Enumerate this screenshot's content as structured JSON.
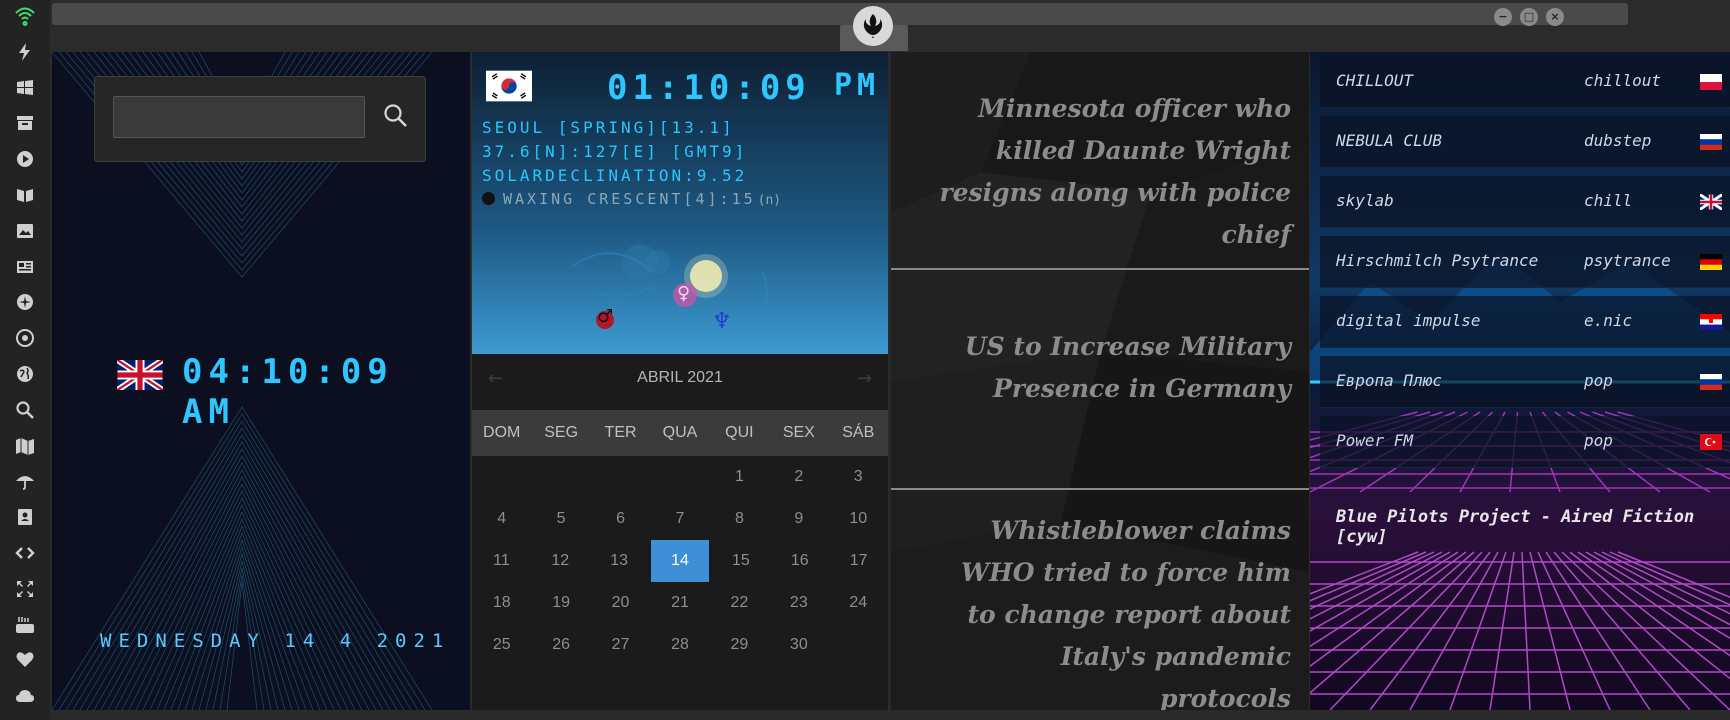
{
  "rail": {
    "icons": [
      "wifi-icon",
      "bolt-icon",
      "windows-icon",
      "archive-icon",
      "play-icon",
      "book-icon",
      "image-icon",
      "news-icon",
      "rebel-icon",
      "empire-icon",
      "globe-icon",
      "search-icon",
      "map-icon",
      "umbrella-icon",
      "contacts-icon",
      "code-icon",
      "fullscreen-icon",
      "youtube-icon",
      "heart-icon",
      "cloud-icon"
    ]
  },
  "topbar": {
    "window_buttons": [
      "−",
      "□",
      "×"
    ]
  },
  "uk_clock": {
    "search_placeholder": "",
    "time": "04:10:09 AM",
    "date": "WEDNESDAY 14 4 2021"
  },
  "seoul": {
    "time": "01:10:09",
    "ampm": "PM",
    "line1": "SEOUL [SPRING][13.1]",
    "line2": "37.6[N]:127[E] [GMT9]",
    "line3": "SOLARDECLINATION:9.52",
    "moon": "WAXING CRESCENT[4]:15",
    "moon_suffix": "(n)",
    "planet_symbols": [
      "♀",
      "♂",
      "♆"
    ]
  },
  "calendar": {
    "prev": "←",
    "next": "→",
    "month": "ABRIL 2021",
    "weekdays": [
      "DOM",
      "SEG",
      "TER",
      "QUA",
      "QUI",
      "SEX",
      "SÁB"
    ],
    "weeks": [
      [
        "",
        "",
        "",
        "",
        "1",
        "2",
        "3"
      ],
      [
        "4",
        "5",
        "6",
        "7",
        "8",
        "9",
        "10"
      ],
      [
        "11",
        "12",
        "13",
        "14",
        "15",
        "16",
        "17"
      ],
      [
        "18",
        "19",
        "20",
        "21",
        "22",
        "23",
        "24"
      ],
      [
        "25",
        "26",
        "27",
        "28",
        "29",
        "30",
        ""
      ]
    ],
    "today": "14"
  },
  "news": {
    "items": [
      "Minnesota officer who killed Daunte Wright resigns along with police chief",
      "US to Increase Military Presence in Germany",
      "Whistleblower claims WHO tried to force him to change report about Italy's pandemic protocols"
    ]
  },
  "radio": {
    "stations": [
      {
        "name": "CHILLOUT",
        "genre": "chillout",
        "flag": "poland"
      },
      {
        "name": "NEBULA CLUB",
        "genre": "dubstep",
        "flag": "russia"
      },
      {
        "name": "skylab",
        "genre": "chill",
        "flag": "uk"
      },
      {
        "name": "Hirschmilch Psytrance",
        "genre": "psytrance",
        "flag": "germany"
      },
      {
        "name": "digital impulse",
        "genre": "e.nic",
        "flag": "croatia"
      },
      {
        "name": "Европа Плюс",
        "genre": "pop",
        "flag": "russia"
      },
      {
        "name": "Power FM",
        "genre": "pop",
        "flag": "turkey"
      }
    ],
    "now_playing": "Blue Pilots Project - Aired Fiction [cyw]"
  },
  "colors": {
    "accent_cyan": "#2ec6ff",
    "calendar_today": "#3f8fd6",
    "news_text": "#8c8c8c"
  }
}
